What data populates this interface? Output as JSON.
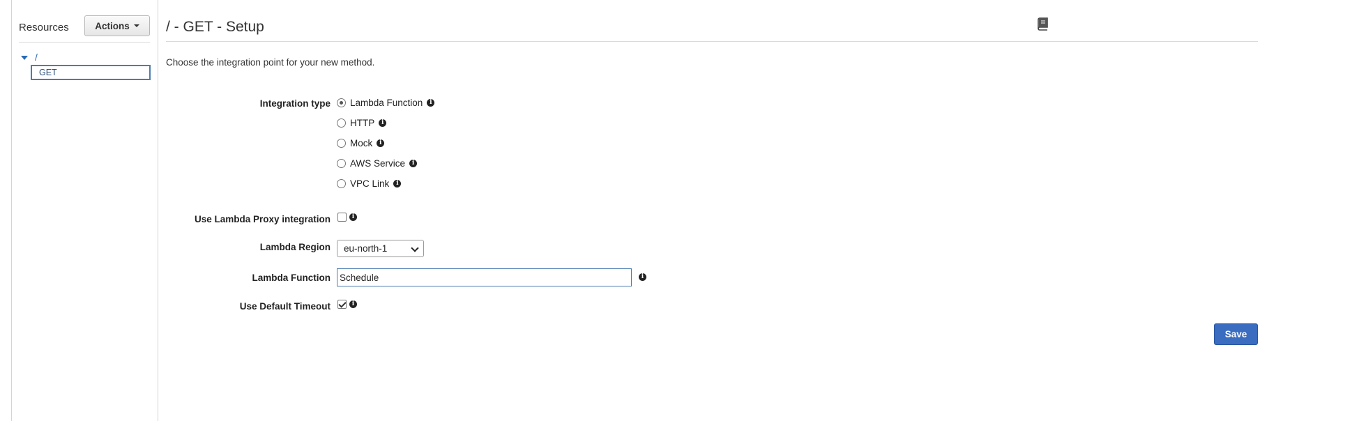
{
  "sidebar": {
    "title": "Resources",
    "actions_label": "Actions",
    "tree": {
      "root": "/",
      "selected": "GET"
    }
  },
  "main": {
    "title": "/ - GET - Setup",
    "intro": "Choose the integration point for your new method.",
    "integration_type": {
      "label": "Integration type",
      "selected": "Lambda Function",
      "options": [
        "Lambda Function",
        "HTTP",
        "Mock",
        "AWS Service",
        "VPC Link"
      ]
    },
    "proxy": {
      "label": "Use Lambda Proxy integration",
      "checked": false
    },
    "region": {
      "label": "Lambda Region",
      "value": "eu-north-1"
    },
    "function": {
      "label": "Lambda Function",
      "value": "Schedule"
    },
    "timeout": {
      "label": "Use Default Timeout",
      "checked": true
    },
    "save_label": "Save"
  },
  "icons": {
    "info": "info-icon",
    "docs": "book-icon",
    "tree_toggle": "triangle-down-icon"
  },
  "colors": {
    "accent": "#3a6cc0",
    "link": "#2a6ab8"
  }
}
